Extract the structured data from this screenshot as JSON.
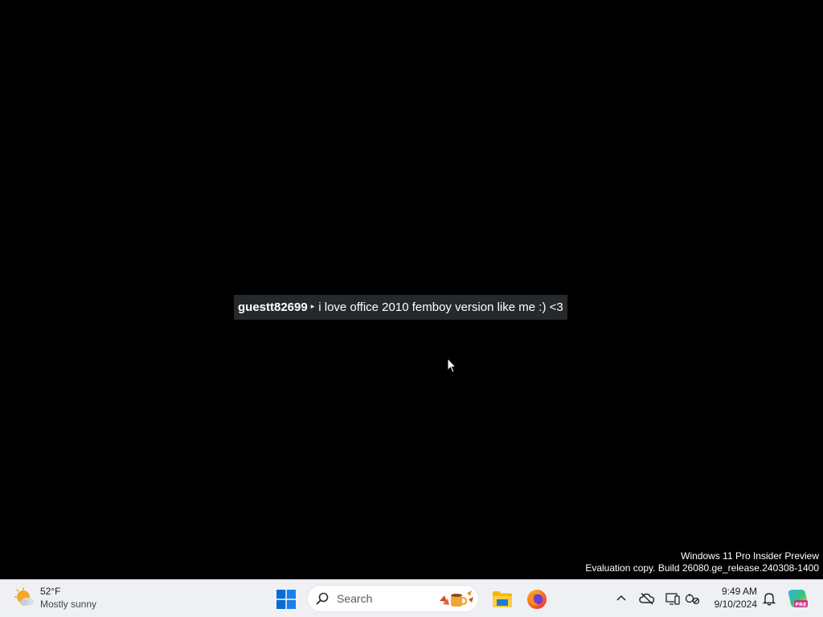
{
  "chat": {
    "username": "guestt82699",
    "separator": "▸",
    "message": "i love office 2010 femboy version like me :) <3"
  },
  "watermark": {
    "line1": "Windows 11 Pro Insider Preview",
    "line2": "Evaluation copy. Build 26080.ge_release.240308-1400"
  },
  "taskbar": {
    "weather": {
      "temp": "52°F",
      "condition": "Mostly sunny",
      "icon": "partly-sunny-icon"
    },
    "search": {
      "placeholder": "Search"
    },
    "apps": [
      {
        "name": "Start",
        "icon": "windows-logo-icon"
      },
      {
        "name": "File Explorer",
        "icon": "folder-icon"
      },
      {
        "name": "Firefox",
        "icon": "firefox-icon"
      }
    ],
    "tray": {
      "icons": [
        "show-hidden-icons-chevron",
        "onedrive-icon",
        "device-icon",
        "network-icon"
      ],
      "time": "9:49 AM",
      "date": "9/10/2024"
    }
  },
  "colors": {
    "desktop_bg": "#000000",
    "taskbar_bg": "#eef0f3",
    "windows_blue": "#0a6cd6",
    "folder_yellow": "#f5b800"
  }
}
